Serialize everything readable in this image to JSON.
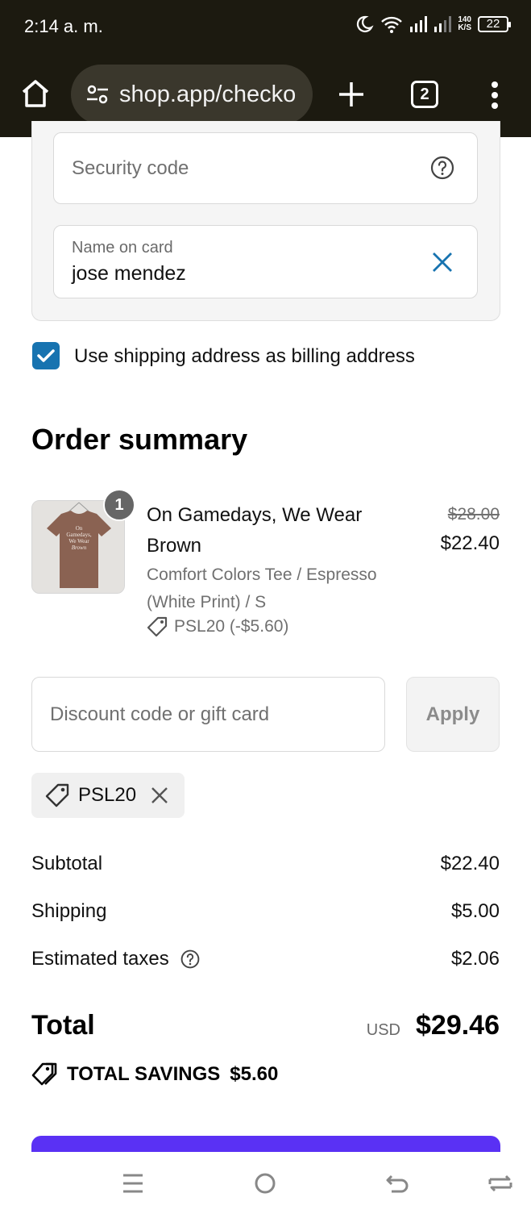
{
  "status_bar": {
    "time": "2:14 a. m.",
    "speed_value": "140",
    "speed_unit": "K/S",
    "battery": "22"
  },
  "browser": {
    "url": "shop.app/checko",
    "tab_count": "2"
  },
  "payment": {
    "security_code_placeholder": "Security code",
    "name_label": "Name on card",
    "name_value": "jose mendez",
    "billing_checkbox_label": "Use shipping address as billing address",
    "billing_checked": true
  },
  "order_summary": {
    "title": "Order summary",
    "item": {
      "quantity": "1",
      "title": "On Gamedays, We Wear Brown",
      "variant": "Comfort Colors Tee / Espresso (White Print) / S",
      "discount": "PSL20 (-$5.60)",
      "original_price": "$28.00",
      "price": "$22.40",
      "thumb_text": [
        "On",
        "Gamedays,",
        "We Wear",
        "Brown"
      ]
    },
    "discount_placeholder": "Discount code or gift card",
    "apply_label": "Apply",
    "applied_code": "PSL20",
    "rows": [
      {
        "label": "Subtotal",
        "value": "$22.40"
      },
      {
        "label": "Shipping",
        "value": "$5.00"
      },
      {
        "label": "Estimated taxes",
        "value": "$2.06"
      }
    ],
    "total_label": "Total",
    "currency": "USD",
    "total_value": "$29.46",
    "savings_label": "TOTAL SAVINGS",
    "savings_value": "$5.60"
  },
  "colors": {
    "accent": "#1773b0",
    "pay_button": "#5a31f4",
    "chrome_bg": "#1c1a10"
  },
  "icons": [
    "home-icon",
    "tune-icon",
    "plus-icon",
    "tabs-icon",
    "more-vert-icon",
    "help-icon",
    "close-icon",
    "check-icon",
    "tag-icon",
    "savings-tag-icon",
    "nav-menu-icon",
    "nav-home-icon",
    "nav-back-icon",
    "nav-switch-icon"
  ]
}
